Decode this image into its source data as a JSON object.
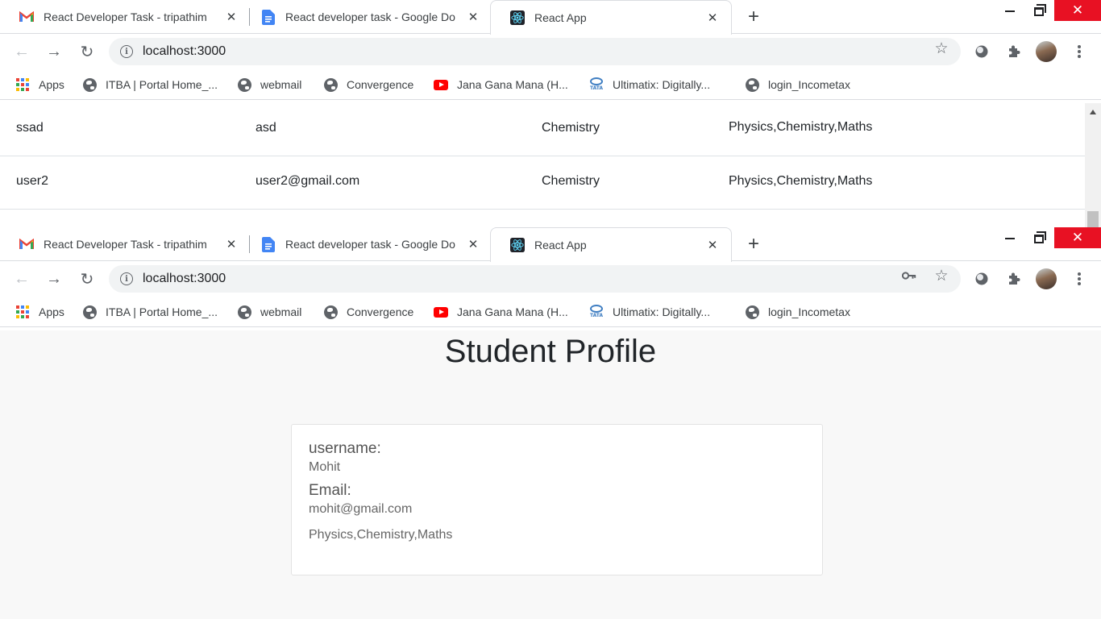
{
  "tabs": [
    {
      "title": "React Developer Task - tripathim",
      "favicon": "gmail-icon"
    },
    {
      "title": "React developer task - Google Do",
      "favicon": "google-docs-icon"
    },
    {
      "title": "React App",
      "favicon": "react-icon"
    }
  ],
  "toolbar": {
    "url": "localhost:3000"
  },
  "bookmarks": [
    {
      "label": "Apps",
      "icon": "apps-icon"
    },
    {
      "label": "ITBA | Portal Home_...",
      "icon": "globe-icon"
    },
    {
      "label": "webmail",
      "icon": "globe-icon"
    },
    {
      "label": "Convergence",
      "icon": "globe-icon"
    },
    {
      "label": "Jana Gana Mana (H...",
      "icon": "youtube-icon"
    },
    {
      "label": "Ultimatix: Digitally...",
      "icon": "tata-icon"
    },
    {
      "label": "login_Incometax",
      "icon": "globe-icon"
    }
  ],
  "tata_logo_text": "TATA",
  "table": {
    "rows": [
      {
        "username": "ssad",
        "email": "asd",
        "subject": "Chemistry",
        "subjects": "Physics,Chemistry,Maths"
      },
      {
        "username": "user2",
        "email": "user2@gmail.com",
        "subject": "Chemistry",
        "subjects": "Physics,Chemistry,Maths"
      }
    ]
  },
  "profile": {
    "title": "Student Profile",
    "username_label": "username:",
    "username_value": "Mohit",
    "email_label": "Email:",
    "email_value": "mohit@gmail.com",
    "subjects": "Physics,Chemistry,Maths"
  },
  "colors": {
    "close_button": "#e81123",
    "page_background": "#f8f8f8",
    "react_icon": "#61dafb",
    "docs_icon": "#4285f4",
    "youtube_icon": "#ff0000"
  }
}
